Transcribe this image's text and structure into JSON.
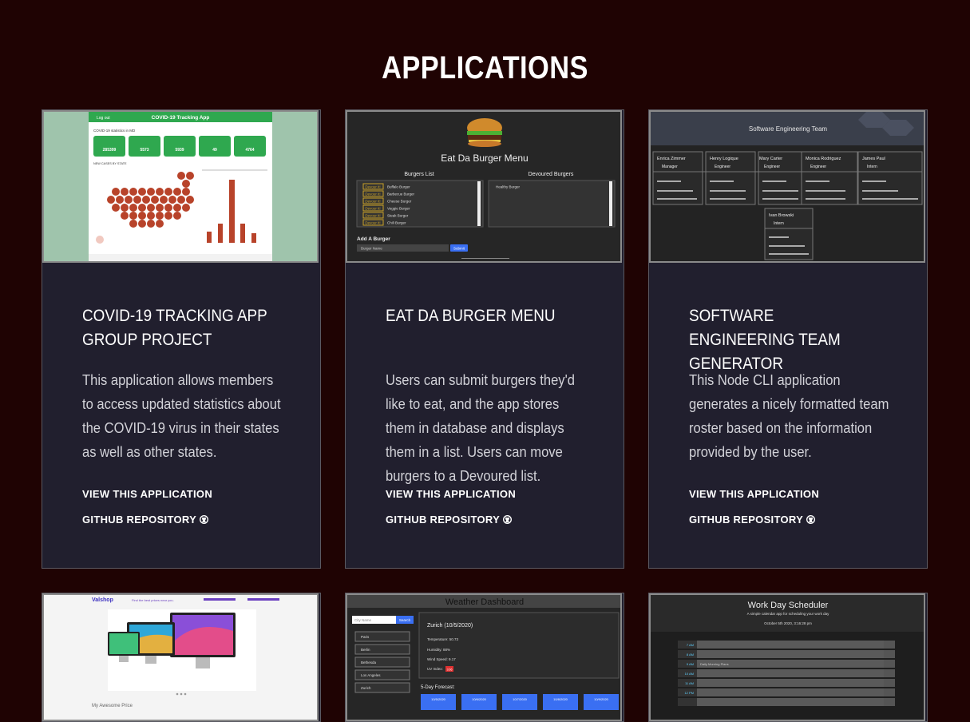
{
  "page": {
    "title": "APPLICATIONS"
  },
  "projects": [
    {
      "title": "COVID-19 TRACKING APP GROUP PROJECT",
      "description": "This application allows members to access updated statistics about the COVID-19 virus in their states as well as other states.",
      "view_link": "VIEW THIS APPLICATION",
      "github_link": "GITHUB REPOSITORY",
      "thumbnail": {
        "app_title": "COVID-19 Tracking App",
        "logout": "Log out",
        "subtitle": "COVID-19 statistics in MD",
        "stats": [
          "285399",
          "5573",
          "5939",
          "49",
          "4764"
        ],
        "map_label": "NEW CASES BY STATE"
      }
    },
    {
      "title": "EAT DA BURGER MENU",
      "description": "Users can submit burgers they'd like to eat, and the app stores them in database and displays them in a list. Users can move burgers to a Devoured list.",
      "view_link": "VIEW THIS APPLICATION",
      "github_link": "GITHUB REPOSITORY",
      "thumbnail": {
        "app_title": "Eat Da Burger Menu",
        "list_header": "Burgers List",
        "devoured_header": "Devoured Burgers",
        "burgers": [
          "Buffalo Burger",
          "Barbecue Burger",
          "Cheese Burger",
          "Veggie Burger",
          "Steak Burger",
          "Chili Burger"
        ],
        "devour_button": "Devour it!",
        "devoured": [
          "Healthy Burger"
        ],
        "add_label": "Add A Burger",
        "input_placeholder": "Burger Name",
        "submit": "Submit"
      }
    },
    {
      "title": "SOFTWARE ENGINEERING TEAM GENERATOR",
      "description": "This Node CLI application generates a nicely formatted team roster based on the information provided by the user.",
      "view_link": "VIEW THIS APPLICATION",
      "github_link": "GITHUB REPOSITORY",
      "thumbnail": {
        "app_title": "Software Engineering Team",
        "members": [
          {
            "name": "Enrica Zimmer",
            "role": "Manager"
          },
          {
            "name": "Henry Logique",
            "role": "Engineer"
          },
          {
            "name": "Mary Carter",
            "role": "Engineer"
          },
          {
            "name": "Monica Rodriguez",
            "role": "Engineer"
          },
          {
            "name": "James Paul",
            "role": "Intern"
          }
        ],
        "extra_member": {
          "name": "Ivan Browski",
          "role": "Intern"
        }
      }
    }
  ],
  "second_row": [
    {
      "thumbnail": {
        "brand": "Valshop",
        "tagline": "Find the best prices near you.",
        "product_label": "My Awesome Price"
      }
    },
    {
      "thumbnail": {
        "app_title": "Weather Dashboard",
        "search_placeholder": "City Name",
        "search_button": "Search",
        "cities": [
          "Paris",
          "Berlin",
          "Bethesda",
          "Los Angeles",
          "Zurich"
        ],
        "current": "Zurich (10/5/2020)",
        "details": [
          "Temperature: 50.73",
          "Humidity: 88%",
          "Wind Speed: 9.17",
          "UV Index:"
        ],
        "uv_value": "3.66",
        "forecast_label": "5-Day Forecast:",
        "forecast_dates": [
          "10/5/2020",
          "10/6/2020",
          "10/7/2020",
          "10/8/2020",
          "10/9/2020"
        ]
      }
    },
    {
      "thumbnail": {
        "app_title": "Work Day Scheduler",
        "subtitle": "A simple calendar app for scheduling your work day",
        "date": "October 5th 2020, 3:16:28 pm",
        "hours": [
          "7 AM",
          "8 AM",
          "9 AM",
          "10 AM",
          "11 AM",
          "12 PM"
        ],
        "entry": "Daily Morning Plans"
      }
    }
  ],
  "colors": {
    "background": "#1f0303",
    "card": "#211f2e",
    "accent_green": "#2fa84f",
    "accent_blue": "#3a6ff2"
  }
}
